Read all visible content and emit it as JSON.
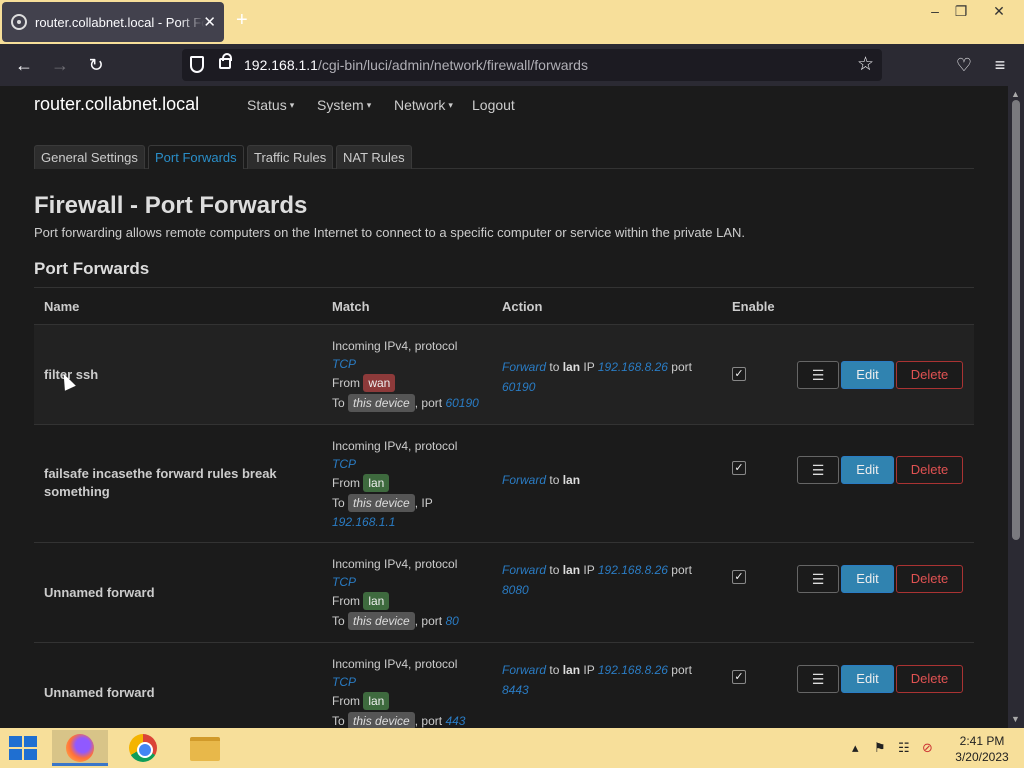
{
  "browser": {
    "tab_title": "router.collabnet.local - Port Forwards",
    "url_host": "192.168.1.1",
    "url_path": "/cgi-bin/luci/admin/network/firewall/forwards",
    "win_minimize": "–",
    "win_restore": "❐",
    "win_close": "✕"
  },
  "header": {
    "brand": "router.collabnet.local",
    "menu": [
      "Status",
      "System",
      "Network",
      "Logout"
    ]
  },
  "tabs": [
    "General Settings",
    "Port Forwards",
    "Traffic Rules",
    "NAT Rules"
  ],
  "active_tab": "Port Forwards",
  "page": {
    "title": "Firewall - Port Forwards",
    "description": "Port forwarding allows remote computers on the Internet to connect to a specific computer or service within the private LAN.",
    "section_title": "Port Forwards"
  },
  "table": {
    "headers": [
      "Name",
      "Match",
      "Action",
      "Enable"
    ],
    "rows": [
      {
        "name": "filter ssh",
        "match_l1": "Incoming IPv4, protocol",
        "protocol": "TCP",
        "from_label": "From",
        "from": "wan",
        "to_label": "To",
        "to": "this device",
        "to_suffix": ", port",
        "to_value": "60190",
        "action_verb": "Forward",
        "action_to": "to",
        "action_zone": "lan",
        "action_ip_label": "IP",
        "action_ip": "192.168.8.26",
        "action_port_label": "port",
        "action_port": "60190",
        "enabled": true
      },
      {
        "name": "failsafe incasethe forward rules break something",
        "match_l1": "Incoming IPv4, protocol",
        "protocol": "TCP",
        "from_label": "From",
        "from": "lan",
        "to_label": "To",
        "to": "this device",
        "to_suffix": ", IP",
        "to_value": "192.168.1.1",
        "action_verb": "Forward",
        "action_to": "to",
        "action_zone": "lan",
        "enabled": true
      },
      {
        "name": "Unnamed forward",
        "match_l1": "Incoming IPv4, protocol",
        "protocol": "TCP",
        "from_label": "From",
        "from": "lan",
        "to_label": "To",
        "to": "this device",
        "to_suffix": ", port",
        "to_value": "80",
        "action_verb": "Forward",
        "action_to": "to",
        "action_zone": "lan",
        "action_ip_label": "IP",
        "action_ip": "192.168.8.26",
        "action_port_label": "port",
        "action_port": "8080",
        "enabled": true
      },
      {
        "name": "Unnamed forward",
        "match_l1": "Incoming IPv4, protocol",
        "protocol": "TCP",
        "from_label": "From",
        "from": "lan",
        "to_label": "To",
        "to": "this device",
        "to_suffix": ", port",
        "to_value": "443",
        "action_verb": "Forward",
        "action_to": "to",
        "action_zone": "lan",
        "action_ip_label": "IP",
        "action_ip": "192.168.8.26",
        "action_port_label": "port",
        "action_port": "8443",
        "enabled": true
      }
    ],
    "buttons": {
      "menu": "☰",
      "edit": "Edit",
      "delete": "Delete"
    },
    "checkmark": "✓"
  },
  "taskbar": {
    "time": "2:41 PM",
    "date": "3/20/2023"
  },
  "icons": {
    "tab_close": "✕",
    "new_tab": "+",
    "back": "←",
    "forward": "→",
    "reload": "↻",
    "star": "☆",
    "pocket": "♡",
    "hamburger": "≡",
    "caret": "▾",
    "tray_up": "▴",
    "tray_flag": "⚑",
    "tray_net": "☷",
    "tray_volume": "⊘",
    "scroll_up": "▲",
    "scroll_down": "▼"
  },
  "colors": {
    "accent": "#2a8ec8",
    "edit_button": "#3083b0",
    "delete_text": "#e05252",
    "wan_badge": "#8d3a3a",
    "lan_badge": "#3e6a3e",
    "chrome_bar": "#f7df9a"
  }
}
